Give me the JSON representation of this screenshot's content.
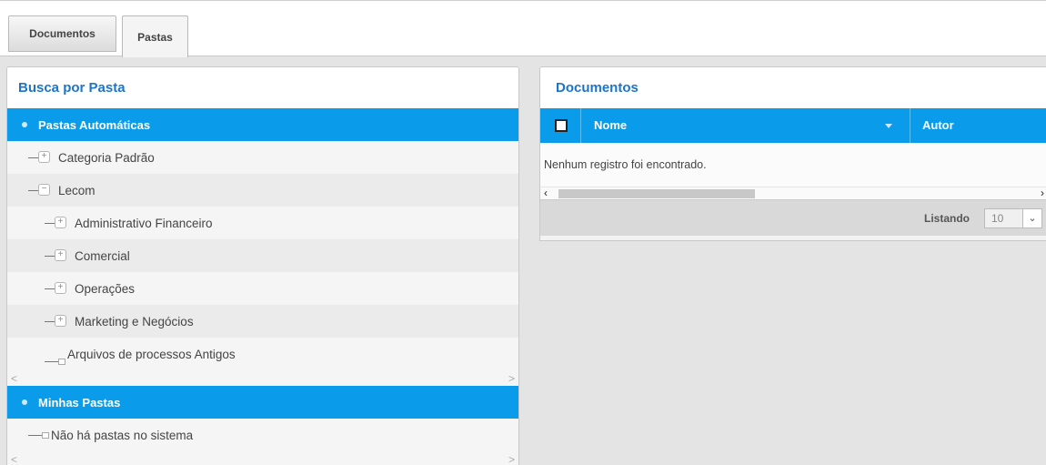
{
  "tabs": [
    {
      "label": "Documentos"
    },
    {
      "label": "Pastas"
    }
  ],
  "left": {
    "title": "Busca por Pasta",
    "auto_header": "Pastas Automáticas",
    "auto_items": [
      {
        "label": "Categoria Padrão",
        "icon": "plus"
      },
      {
        "label": "Lecom",
        "icon": "minus"
      },
      {
        "label": "Administrativo Financeiro",
        "icon": "plus"
      },
      {
        "label": "Comercial",
        "icon": "plus"
      },
      {
        "label": "Operações",
        "icon": "plus"
      },
      {
        "label": "Marketing e Negócios",
        "icon": "plus"
      },
      {
        "label": "Arquivos de processos Antigos",
        "icon": "leaf"
      }
    ],
    "mine_header": "Minhas Pastas",
    "mine_items": [
      {
        "label": "Não há pastas no sistema",
        "icon": "leaf"
      }
    ]
  },
  "right": {
    "title": "Documentos",
    "columns": [
      "Nome",
      "Autor"
    ],
    "empty_message": "Nenhum registro foi encontrado.",
    "pager_label": "Listando",
    "page_size": "10"
  },
  "colors": {
    "accent_blue": "#0a9bea",
    "title_blue": "#1e74c6"
  }
}
